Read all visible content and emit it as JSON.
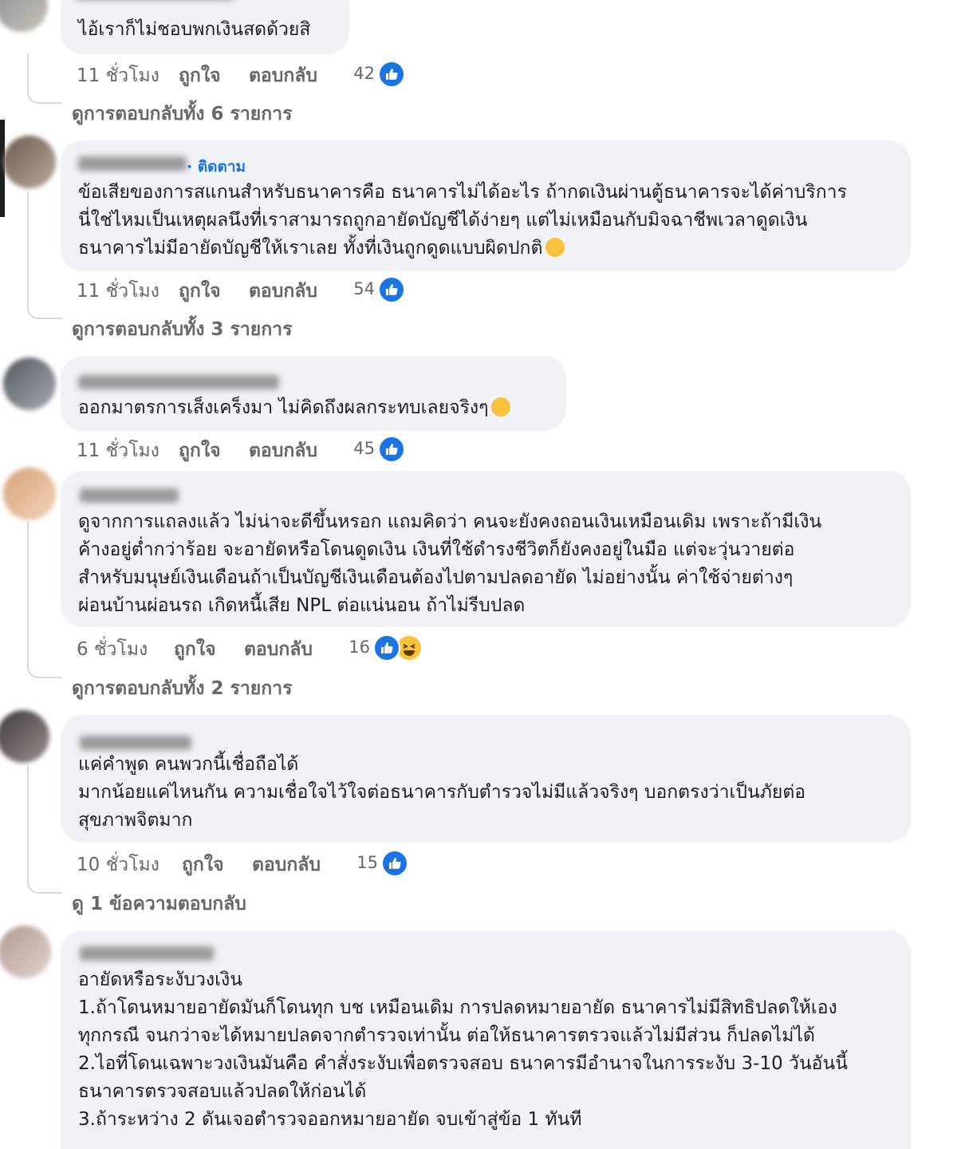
{
  "accent": "#1b74e4",
  "comments": [
    {
      "lines": [
        "ไอ้เราก็ไม่ชอบพกเงินสดด้วยสิ"
      ],
      "time": "11 ชั่วโมง",
      "like_label": "ถูกใจ",
      "reply_label": "ตอบกลับ",
      "reaction_count": "42",
      "reactions": [
        "like-icon"
      ],
      "view_replies": "ดูการตอบกลับทั้ง 6 รายการ"
    },
    {
      "follow_label": "· ติดตาม",
      "lines": [
        "ข้อเสียของการสแกนสำหรับธนาคารคือ ธนาคารไม่ได้อะไร ถ้ากดเงินผ่านตู้ธนาคารจะได้ค่าบริการ",
        "นี่ใช่ไหมเป็นเหตุผลนึงที่เราสามารถถูกอายัดบัญชีได้ง่ายๆ แต่ไม่เหมือนกับมิจฉาชีพเวลาดูดเงิน",
        "ธนาคารไม่มีอายัดบัญชีให้เราเลย ทั้งที่เงินถูกดูดแบบผิดปกติ"
      ],
      "time": "11 ชั่วโมง",
      "like_label": "ถูกใจ",
      "reply_label": "ตอบกลับ",
      "reaction_count": "54",
      "reactions": [
        "like-icon"
      ],
      "view_replies": "ดูการตอบกลับทั้ง 3 รายการ"
    },
    {
      "lines": [
        "ออกมาตรการเส็งเคร็งมา ไม่คิดถึงผลกระทบเลยจริงๆ"
      ],
      "time": "11 ชั่วโมง",
      "like_label": "ถูกใจ",
      "reply_label": "ตอบกลับ",
      "reaction_count": "45",
      "reactions": [
        "like-icon"
      ]
    },
    {
      "lines": [
        "ดูจากการแถลงแล้ว ไม่น่าจะดีขึ้นหรอก แถมคิดว่า คนจะยังคงถอนเงินเหมือนเดิม เพราะถ้ามีเงิน",
        "ค้างอยู่ต่ำกว่าร้อย จะอายัดหรือโดนดูดเงิน เงินที่ใช้ดำรงชีวิตก็ยังคงอยู่ในมือ แต่จะวุ่นวายต่อ",
        "สำหรับมนุษย์เงินเดือนถ้าเป็นบัญชีเงินเดือนต้องไปตามปลดอายัด ไม่อย่างนั้น ค่าใช้จ่ายต่างๆ",
        "ผ่อนบ้านผ่อนรถ เกิดหนี้เสีย NPL ต่อแน่นอน ถ้าไม่รีบปลด"
      ],
      "time": "6 ชั่วโมง",
      "like_label": "ถูกใจ",
      "reply_label": "ตอบกลับ",
      "reaction_count": "16",
      "reactions": [
        "like-icon",
        "haha-icon"
      ],
      "view_replies": "ดูการตอบกลับทั้ง 2 รายการ"
    },
    {
      "lines": [
        "แค่คำพูด คนพวกนี้เชื่อถือได้",
        "มากน้อยแค่ไหนกัน ความเชื่อใจไว้ใจต่อธนาคารกับตำรวจไม่มีแล้วจริงๆ บอกตรงว่าเป็นภัยต่อ",
        "สุขภาพจิตมาก"
      ],
      "time": "10 ชั่วโมง",
      "like_label": "ถูกใจ",
      "reply_label": "ตอบกลับ",
      "reaction_count": "15",
      "reactions": [
        "like-icon"
      ],
      "view_replies": "ดู 1 ข้อความตอบกลับ"
    },
    {
      "lines": [
        "อายัดหรือระงับวงเงิน",
        "1.ถ้าโดนหมายอายัดมันก็โดนทุก บช เหมือนเดิม การปลดหมายอายัด ธนาคารไม่มีสิทธิปลดให้เอง",
        "ทุกกรณี จนกว่าจะได้หมายปลดจากตำรวจเท่านั้น ต่อให้ธนาคารตรวจแล้วไม่มีส่วน ก็ปลดไม่ได้",
        "2.ไอที่โดนเฉพาะวงเงินมันคือ คำสั่งระงับเพื่อตรวจสอบ ธนาคารมีอำนาจในการระงับ 3-10 วันอันนี้",
        "ธนาคารตรวจสอบแล้วปลดให้ก่อนได้",
        "3.ถ้าระหว่าง 2 ดันเจอตำรวจออกหมายอายัด จบเข้าสู่ข้อ 1 ทันที"
      ]
    }
  ]
}
